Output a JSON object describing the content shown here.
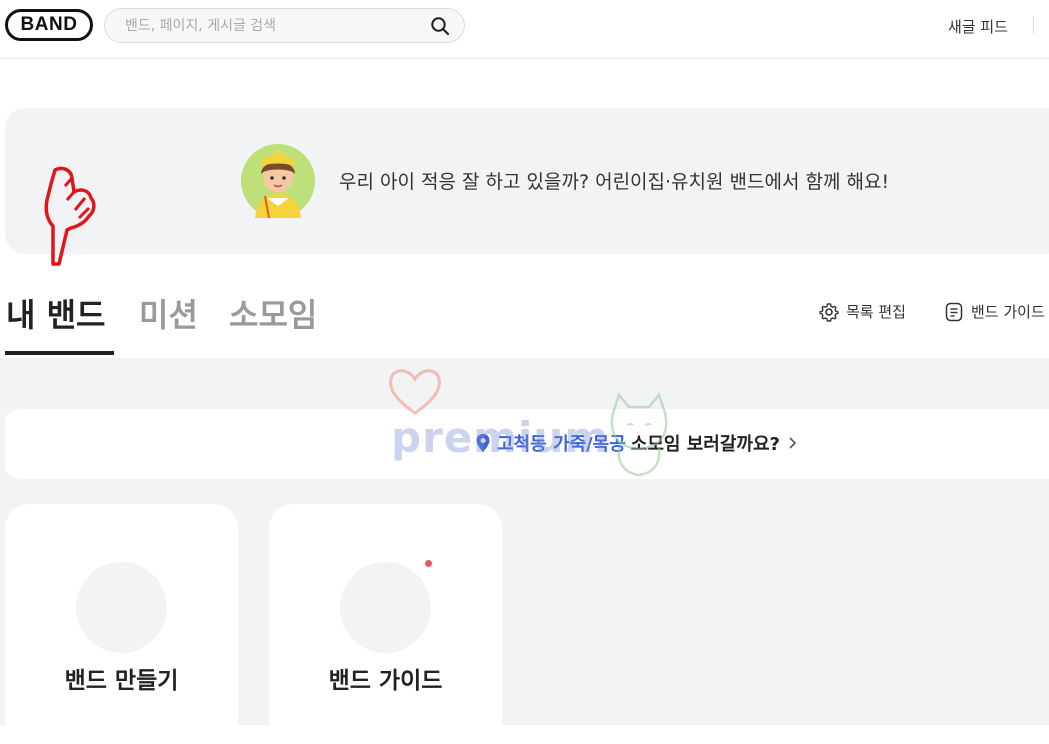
{
  "header": {
    "logo": "BAND",
    "search_placeholder": "밴드, 페이지, 게시글 검색",
    "new_feed": "새글 피드"
  },
  "banner": {
    "text": "우리 아이 적응 잘 하고 있을까? 어린이집·유치원 밴드에서 함께 해요!"
  },
  "tabs": [
    {
      "label": "내 밴드",
      "active": true
    },
    {
      "label": "미션",
      "active": false
    },
    {
      "label": "소모임",
      "active": false
    }
  ],
  "tools": {
    "edit_list": "목록 편집",
    "band_guide": "밴드 가이드"
  },
  "meetup": {
    "location": "고척동 가죽/목공",
    "rest": "소모임 보러갈까요?"
  },
  "cards": [
    {
      "title": "밴드 만들기",
      "has_dot": false
    },
    {
      "title": "밴드 가이드",
      "has_dot": true
    }
  ],
  "watermark": "premium",
  "colors": {
    "accent_blue": "#3a64d8",
    "notification_dot": "#e5575f",
    "background_gray": "#f2f3f5"
  }
}
